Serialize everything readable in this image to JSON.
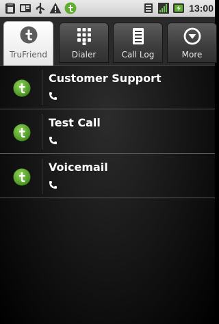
{
  "status_bar": {
    "left_icons": [
      "clipboard-icon",
      "sd-card-icon",
      "usb-icon",
      "warning-icon",
      "trufriend-notification-icon"
    ],
    "right_icons": [
      "wifi-icon",
      "signal-icon",
      "battery-icon"
    ],
    "time": "13:00"
  },
  "tabs": [
    {
      "label": "TruFriend",
      "icon": "trufriend-logo-icon",
      "selected": true
    },
    {
      "label": "Dialer",
      "icon": "dialpad-icon",
      "selected": false
    },
    {
      "label": "Call Log",
      "icon": "call-log-icon",
      "selected": false
    },
    {
      "label": "More",
      "icon": "more-icon",
      "selected": false
    }
  ],
  "contacts": [
    {
      "name": "Customer Support",
      "icon": "trufriend-avatar-icon",
      "detail_icon": "phone-icon"
    },
    {
      "name": "Test Call",
      "icon": "trufriend-avatar-icon",
      "detail_icon": "phone-icon"
    },
    {
      "name": "Voicemail",
      "icon": "trufriend-avatar-icon",
      "detail_icon": "phone-icon"
    }
  ],
  "colors": {
    "accent_green": "#5fae2e",
    "list_divider": "#5a5a5a",
    "status_bar_bg": "#dcdcdc"
  }
}
